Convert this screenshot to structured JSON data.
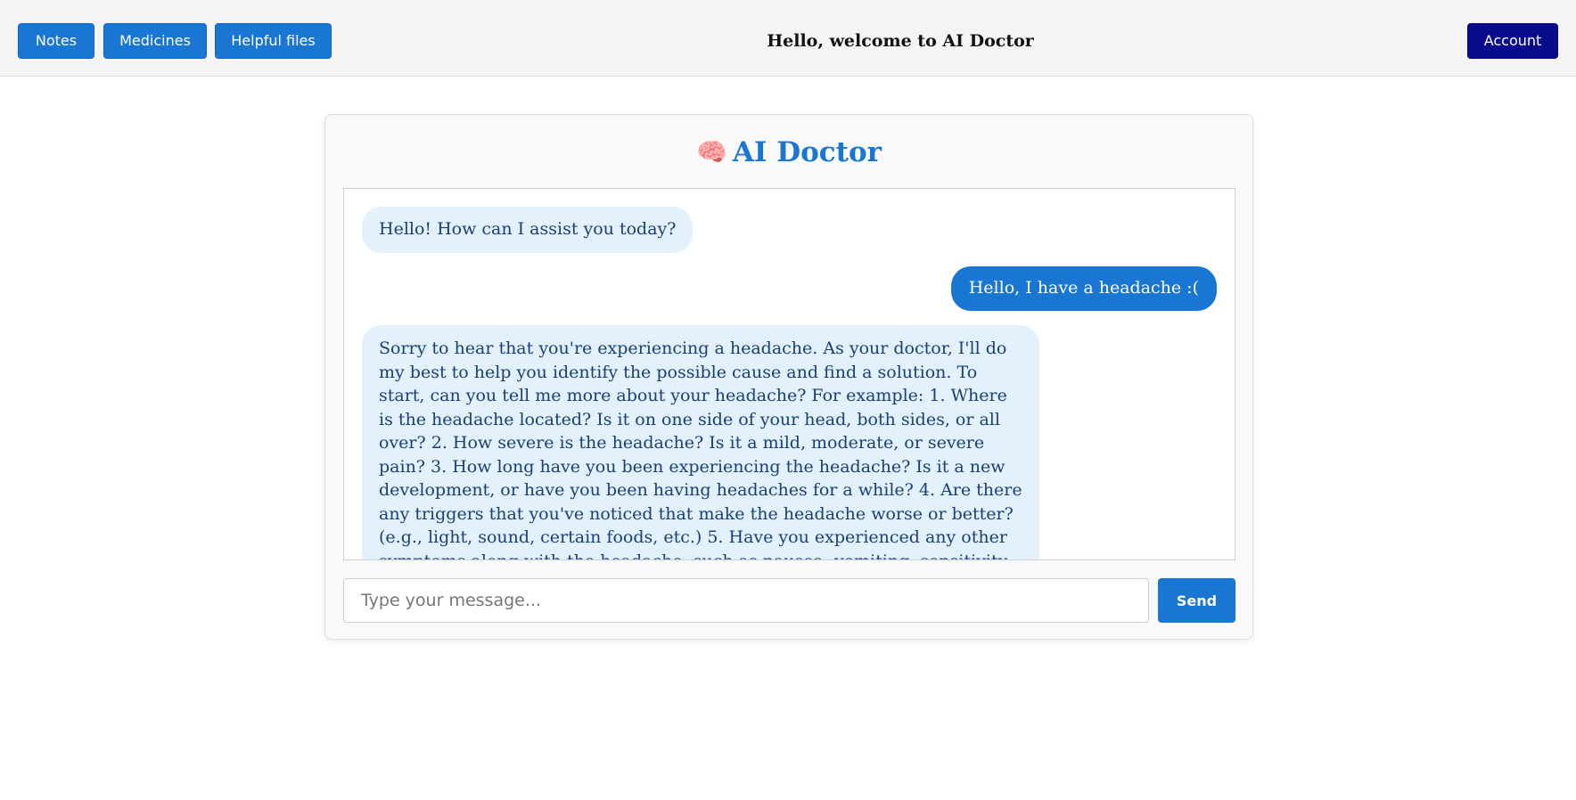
{
  "header": {
    "nav": [
      {
        "label": "Notes"
      },
      {
        "label": "Medicines"
      },
      {
        "label": "Helpful files"
      }
    ],
    "welcome": "Hello, welcome to AI Doctor",
    "account_label": "Account"
  },
  "chat": {
    "title": "AI Doctor",
    "title_icon": "brain-icon",
    "messages": [
      {
        "sender": "bot",
        "text": "Hello! How can I assist you today?"
      },
      {
        "sender": "user",
        "text": "Hello, I have a headache :("
      },
      {
        "sender": "bot",
        "text": "Sorry to hear that you're experiencing a headache. As your doctor, I'll do my best to help you identify the possible cause and find a solution. To start, can you tell me more about your headache? For example: 1. Where is the headache located? Is it on one side of your head, both sides, or all over? 2. How severe is the headache? Is it a mild, moderate, or severe pain? 3. How long have you been experiencing the headache? Is it a new development, or have you been having headaches for a while? 4. Are there any triggers that you've noticed that make the headache worse or better? (e.g., light, sound, certain foods, etc.) 5. Have you experienced any other symptoms along with the headache, such as nausea, vomiting, sensitivity to light, or fever? Based on your answers, I can"
      }
    ],
    "input_placeholder": "Type your message...",
    "input_value": "",
    "send_label": "Send"
  },
  "colors": {
    "primary": "#1976d2",
    "account": "#0a0a8c",
    "bot_bubble": "#e3f1fc",
    "bot_text": "#1a3f74"
  }
}
